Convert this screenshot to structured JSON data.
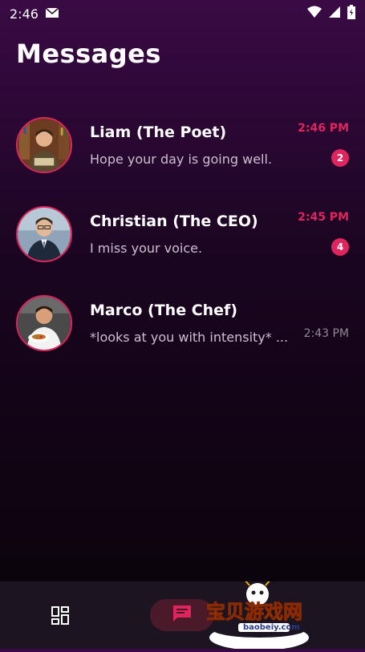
{
  "status_bar": {
    "time": "2:46"
  },
  "header": {
    "title": "Messages"
  },
  "chats": [
    {
      "name": "Liam (The Poet)",
      "preview": "Hope your day is going well.",
      "time": "2:46 PM",
      "unread": "2",
      "avatar_icon": "avatar-reading-man"
    },
    {
      "name": "Christian (The CEO)",
      "preview": "I miss your voice.",
      "time": "2:45 PM",
      "unread": "4",
      "avatar_icon": "avatar-suited-man"
    },
    {
      "name": "Marco (The Chef)",
      "preview": "*looks at you with intensity* ...",
      "time": "2:43 PM",
      "unread": "",
      "avatar_icon": "avatar-chef"
    }
  ],
  "watermark": {
    "text": "宝贝游戏网",
    "url": "baobeiy.com"
  },
  "colors": {
    "accent": "#e0245e",
    "background_top": "#3a0a45",
    "background_bottom": "#080308"
  }
}
